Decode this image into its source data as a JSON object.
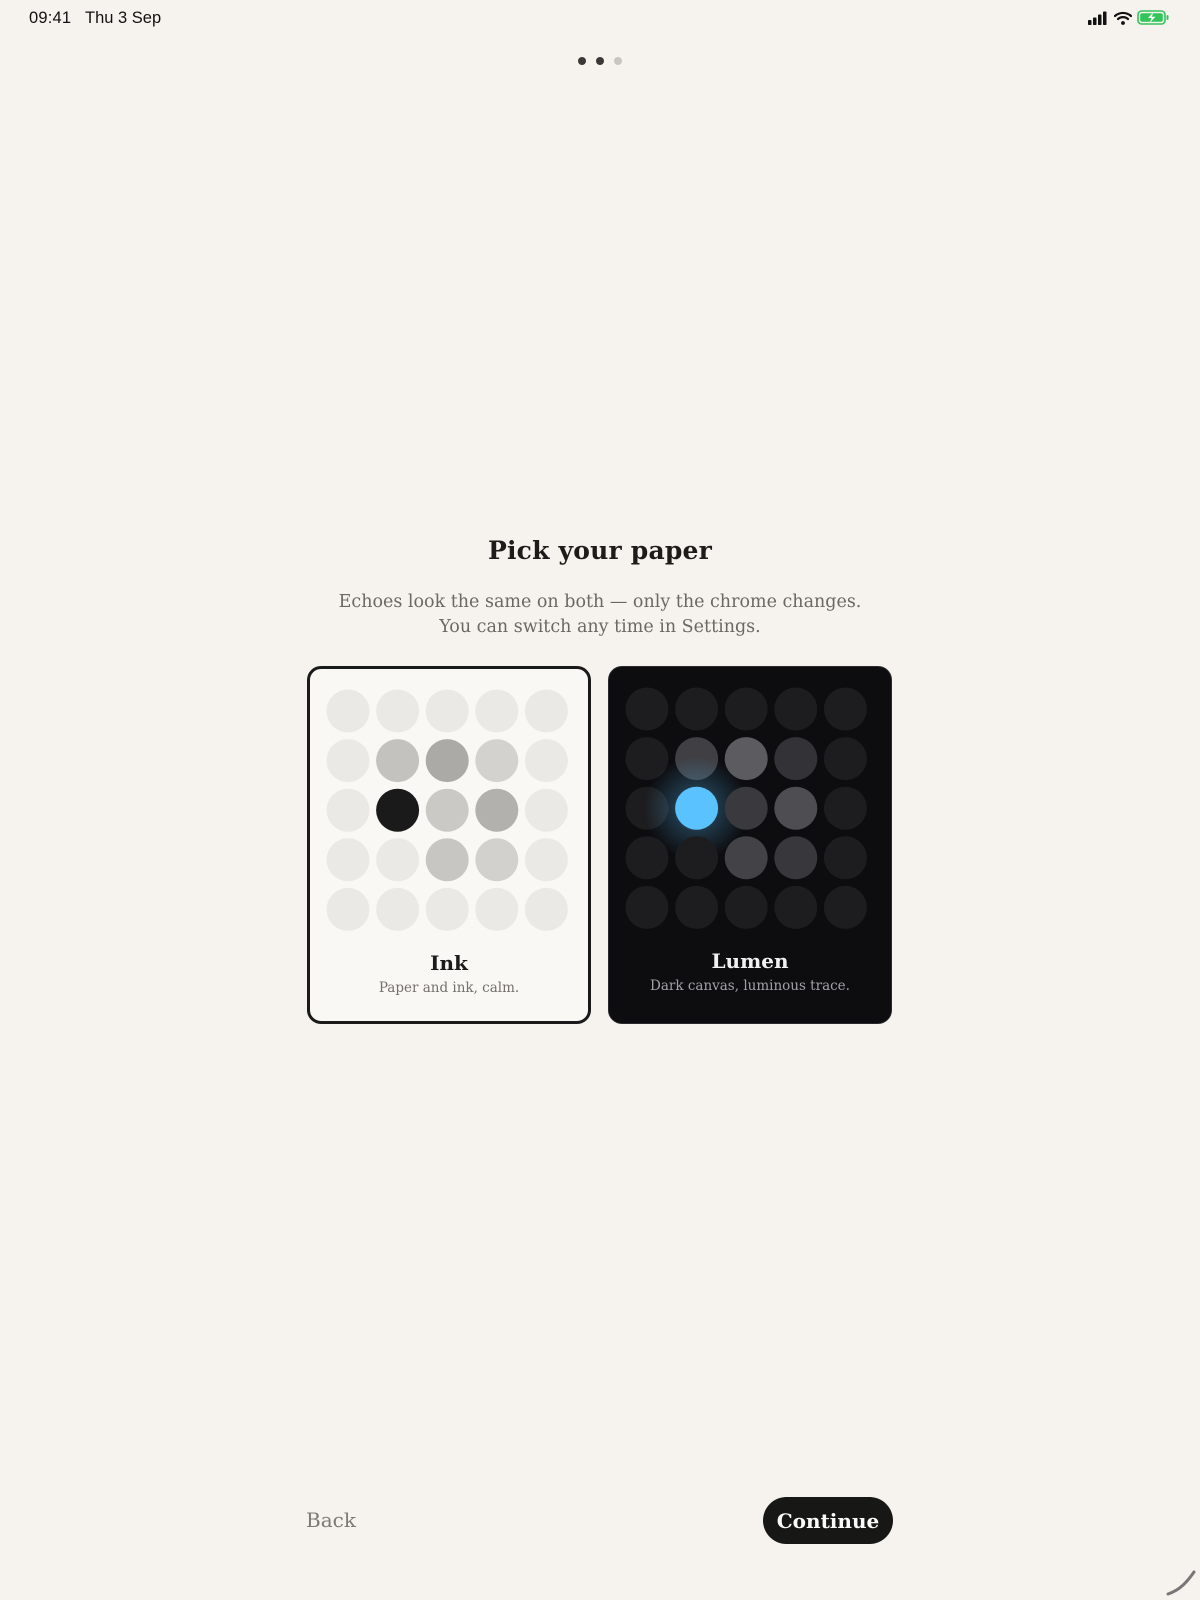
{
  "status_bar": {
    "time": "09:41",
    "date": "Thu 3 Sep",
    "icons": [
      "cellular-signal-icon",
      "wifi-icon",
      "battery-charging-icon"
    ],
    "battery_color": "#33c45a"
  },
  "pager": {
    "total": 3,
    "active_upto": 2
  },
  "onboarding": {
    "title": "Pick your paper",
    "subtitle_line1": "Echoes look the same on both — only the chrome changes.",
    "subtitle_line2": "You can switch any time in Settings."
  },
  "themes": [
    {
      "name": "Ink",
      "description": "Paper and ink, calm.",
      "selected": true,
      "colors": {
        "background": "#f9f8f5",
        "base_dot": "#ebe9e6",
        "accent": "#1a1a1a"
      },
      "preview_grid": [
        [
          "#ebe9e6",
          "#ebe9e6",
          "#ebe9e6",
          "#ebe9e6",
          "#ebe9e6"
        ],
        [
          "#ebe9e6",
          "#c4c2bf",
          "#acaaa7",
          "#d4d2ce",
          "#ebe9e6"
        ],
        [
          "#ebe9e6",
          "#1a1a1a",
          "#cbc9c5",
          "#b3b1ae",
          "#ebe9e6"
        ],
        [
          "#ebe9e6",
          "#ebe9e6",
          "#c8c6c3",
          "#d3d1cd",
          "#ebe9e6"
        ],
        [
          "#ebe9e6",
          "#ebe9e6",
          "#ebe9e6",
          "#ebe9e6",
          "#ebe9e6"
        ]
      ]
    },
    {
      "name": "Lumen",
      "description": "Dark canvas, luminous trace.",
      "selected": false,
      "colors": {
        "background": "#0d0d10",
        "base_dot": "#1d1d20",
        "accent": "#5ac2ff"
      },
      "preview_grid": [
        [
          "#1d1d20",
          "#1d1d20",
          "#1d1d20",
          "#1d1d20",
          "#1d1d20"
        ],
        [
          "#1d1d20",
          "#3f3f44",
          "#5b5b60",
          "#333337",
          "#1d1d20"
        ],
        [
          "#1d1d20",
          "#5ac2ff",
          "#3a3a3e",
          "#4e4e52",
          "#1d1d20"
        ],
        [
          "#1d1d20",
          "#1d1d20",
          "#434347",
          "#38383c",
          "#1d1d20"
        ],
        [
          "#1d1d20",
          "#1d1d20",
          "#1d1d20",
          "#1d1d20",
          "#1d1d20"
        ]
      ]
    }
  ],
  "footer": {
    "back_label": "Back",
    "continue_label": "Continue"
  }
}
